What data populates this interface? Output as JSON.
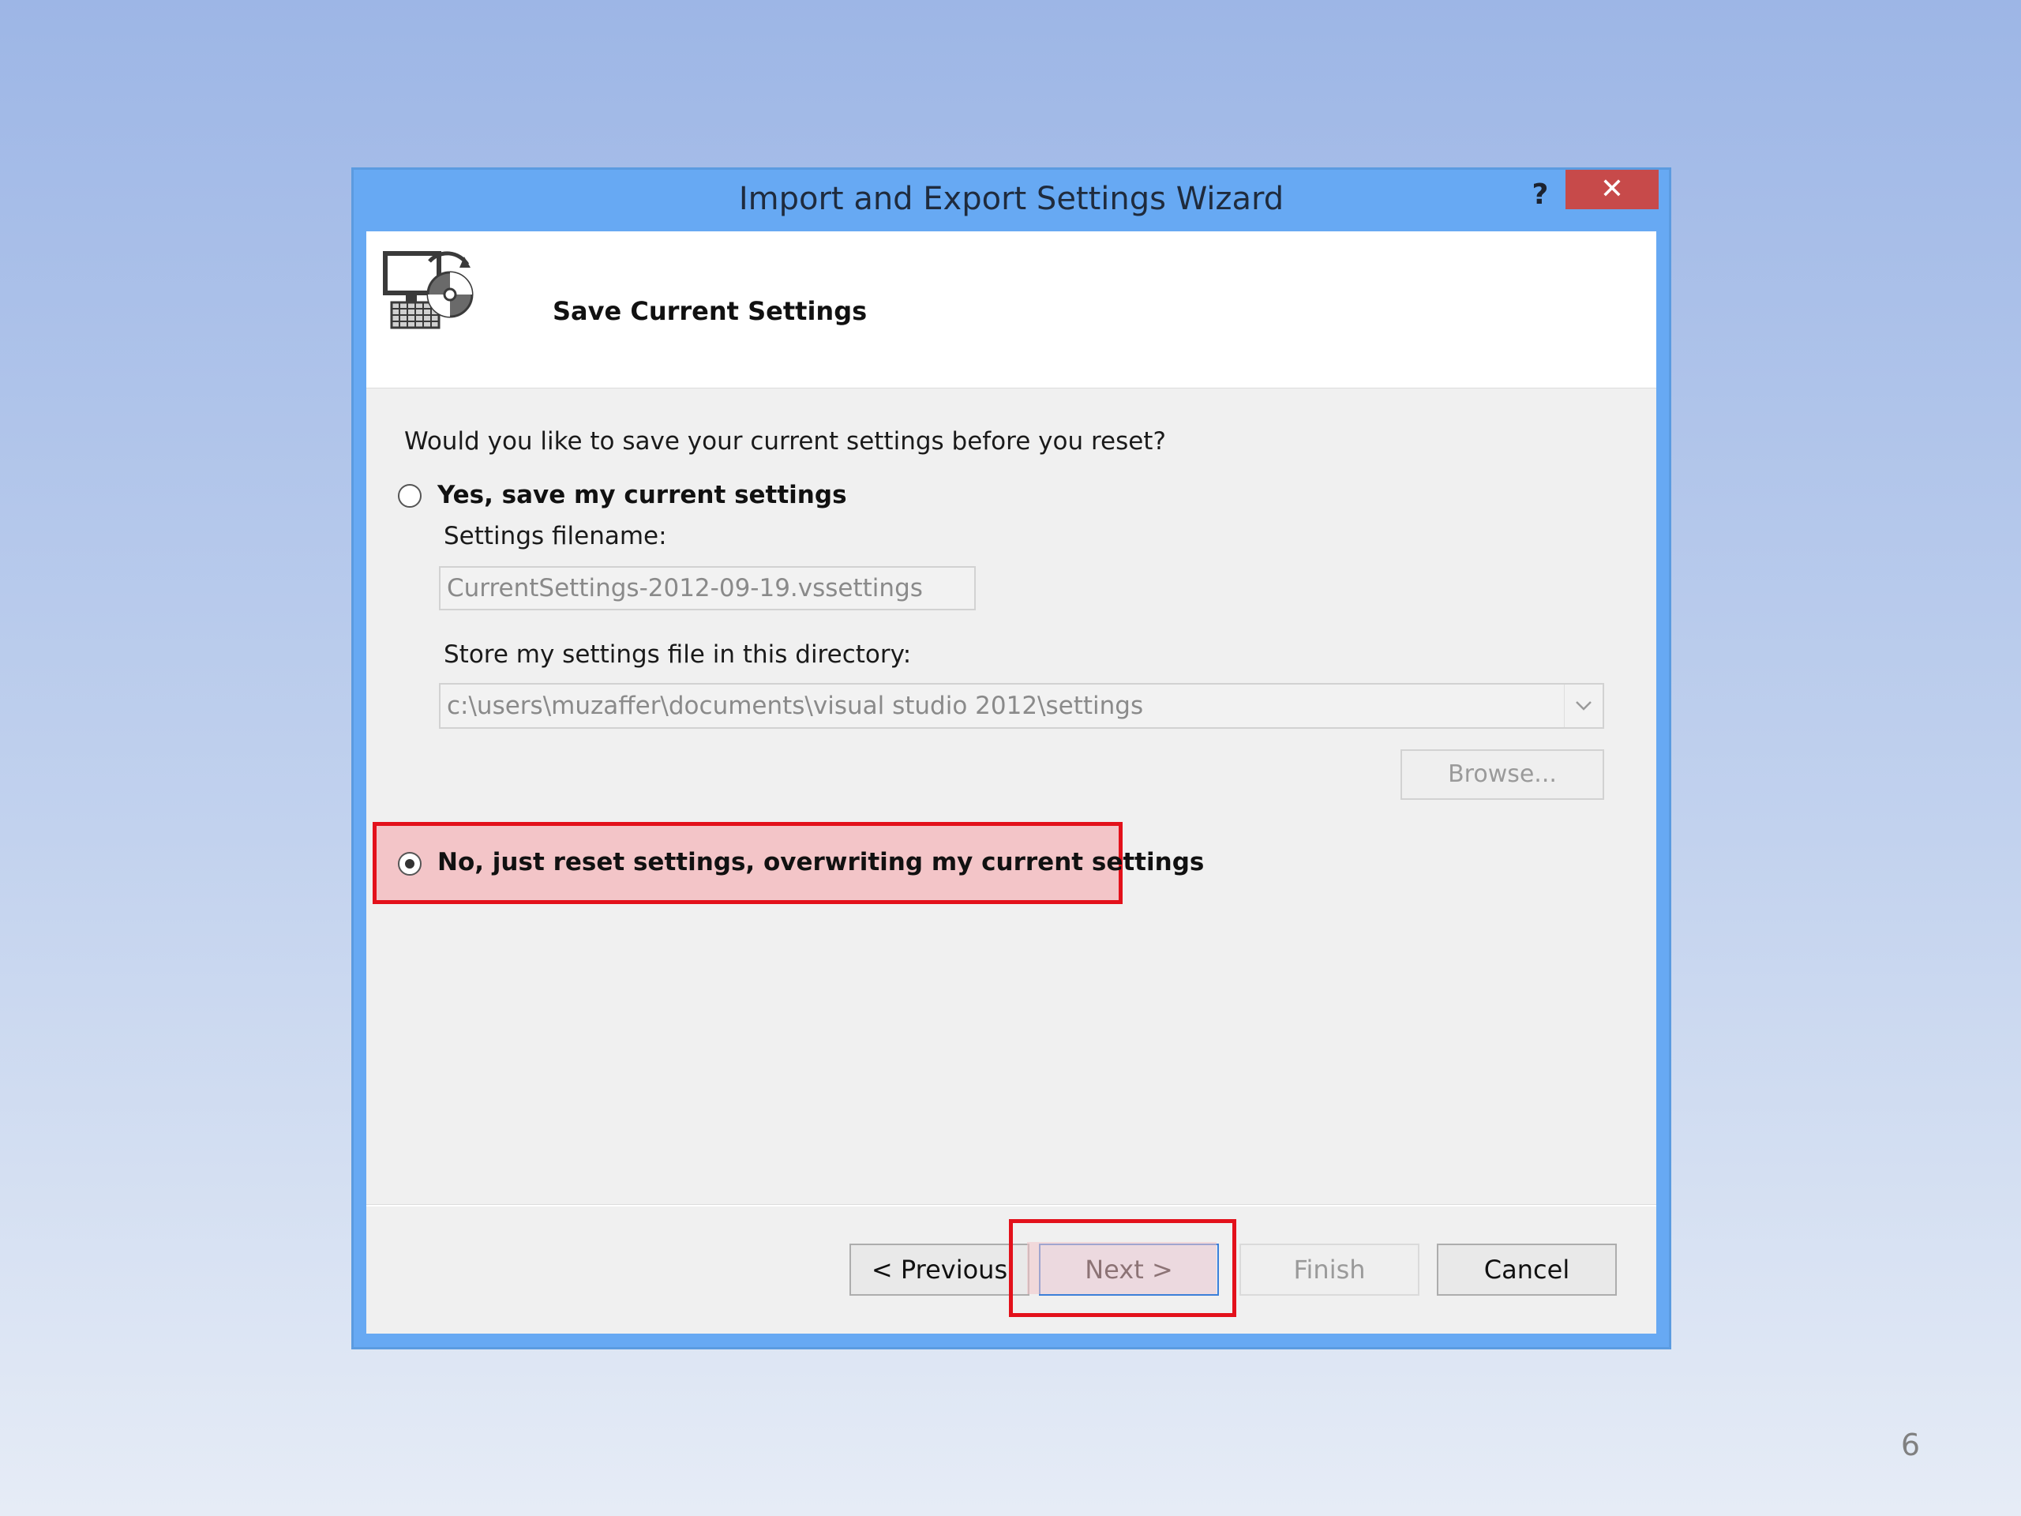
{
  "window": {
    "title": "Import and Export Settings Wizard",
    "help_label": "?",
    "close_label": "✕"
  },
  "header": {
    "title": "Save Current Settings",
    "icon": "computer-settings-icon"
  },
  "body": {
    "question": "Would you like to save your current settings before you reset?",
    "option_yes_label": "Yes, save my current settings",
    "option_yes_checked": false,
    "filename_label": "Settings filename:",
    "filename_value": "CurrentSettings-2012-09-19.vssettings",
    "directory_label": "Store my settings file in this directory:",
    "directory_value": "c:\\users\\muzaffer\\documents\\visual studio 2012\\settings",
    "browse_label": "Browse...",
    "option_no_label": "No, just reset settings, overwriting my current settings",
    "option_no_checked": true
  },
  "footer": {
    "previous_label": "< Previous",
    "next_label": "Next >",
    "finish_label": "Finish",
    "cancel_label": "Cancel"
  },
  "highlight_color": "#e3111b",
  "page_number": "6"
}
